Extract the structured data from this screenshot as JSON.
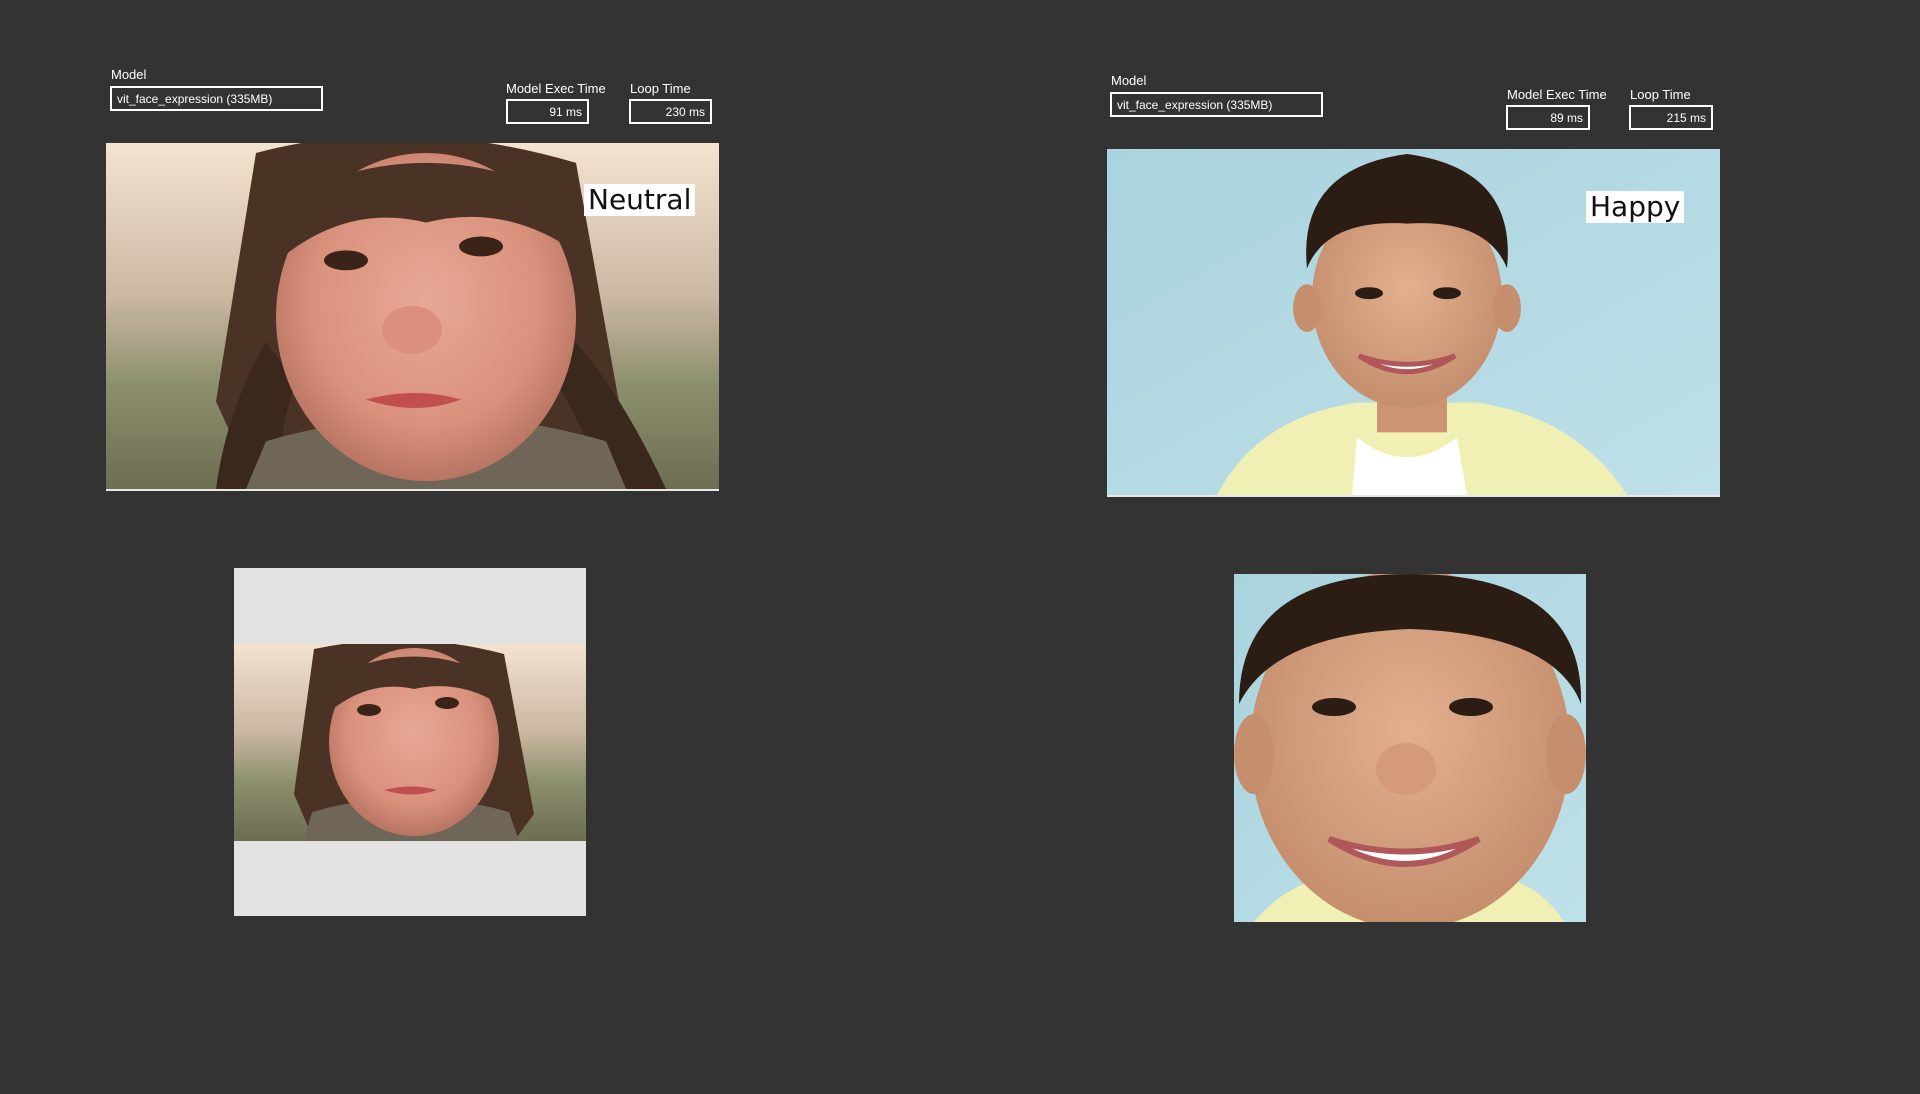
{
  "colors": {
    "background": "#333333",
    "field_border": "#ffffff",
    "letterbox": "#e2e2e2",
    "label_bg": "#ffffff"
  },
  "left_panel": {
    "model_label": "Model",
    "model_value": "vit_face_expression  (335MB)",
    "exec_time_label": "Model Exec Time",
    "exec_time_value": "91 ms",
    "loop_time_label": "Loop Time",
    "loop_time_value": "230 ms",
    "expression": "Neutral"
  },
  "right_panel": {
    "model_label": "Model",
    "model_value": "vit_face_expression  (335MB)",
    "exec_time_label": "Model Exec Time",
    "exec_time_value": "89 ms",
    "loop_time_label": "Loop Time",
    "loop_time_value": "215 ms",
    "expression": "Happy"
  }
}
